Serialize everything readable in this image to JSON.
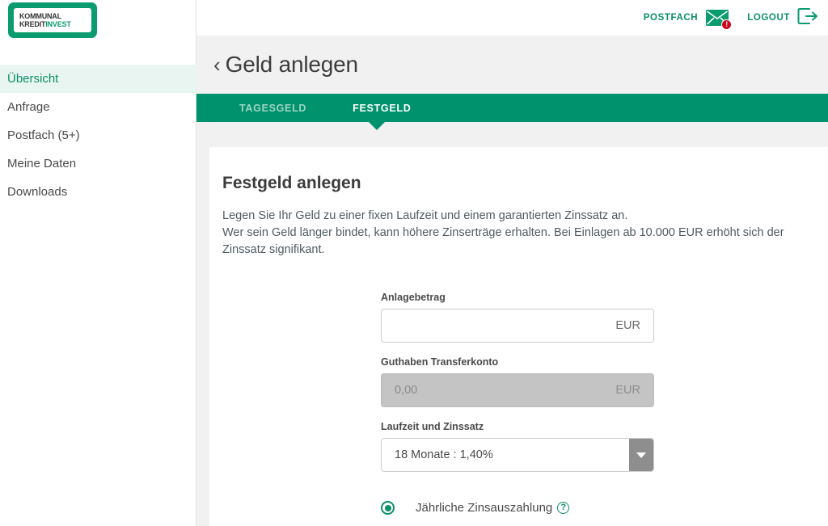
{
  "logo": {
    "line1": "KOMMUNAL",
    "line2_a": "KREDIT",
    "line2_b": "INVEST",
    "brand_green": "#0a9b6e"
  },
  "sidebar": {
    "items": [
      {
        "label": "Übersicht",
        "active": true
      },
      {
        "label": "Anfrage",
        "active": false
      },
      {
        "label": "Postfach (5+)",
        "active": false
      },
      {
        "label": "Meine Daten",
        "active": false
      },
      {
        "label": "Downloads",
        "active": false
      }
    ]
  },
  "header": {
    "postfach_label": "POSTFACH",
    "postfach_badge": "!",
    "logout_label": "LOGOUT",
    "accent_color": "#0a8f68",
    "badge_color": "#d0021b"
  },
  "page": {
    "back_chevron": "‹",
    "title": "Geld anlegen"
  },
  "tabs": [
    {
      "label": "TAGESGELD",
      "active": false
    },
    {
      "label": "FESTGELD",
      "active": true
    }
  ],
  "card": {
    "title": "Festgeld anlegen",
    "description_line1": "Legen Sie Ihr Geld zu einer fixen Laufzeit und einem garantierten Zinssatz an.",
    "description_line2": "Wer sein Geld länger bindet, kann höhere Zinserträge erhalten. Bei Einlagen ab 10.000 EUR erhöht sich der Zinssatz signifikant."
  },
  "form": {
    "amount": {
      "label": "Anlagebetrag",
      "value": "",
      "placeholder": "",
      "suffix": "EUR"
    },
    "balance": {
      "label": "Guthaben Transferkonto",
      "value": "0,00",
      "suffix": "EUR",
      "disabled": true
    },
    "term": {
      "label": "Laufzeit und Zinssatz",
      "selected": "18 Monate : 1,40%"
    },
    "interest_option": {
      "label": "Jährliche Zinsauszahlung",
      "help": "?",
      "selected": true
    }
  }
}
